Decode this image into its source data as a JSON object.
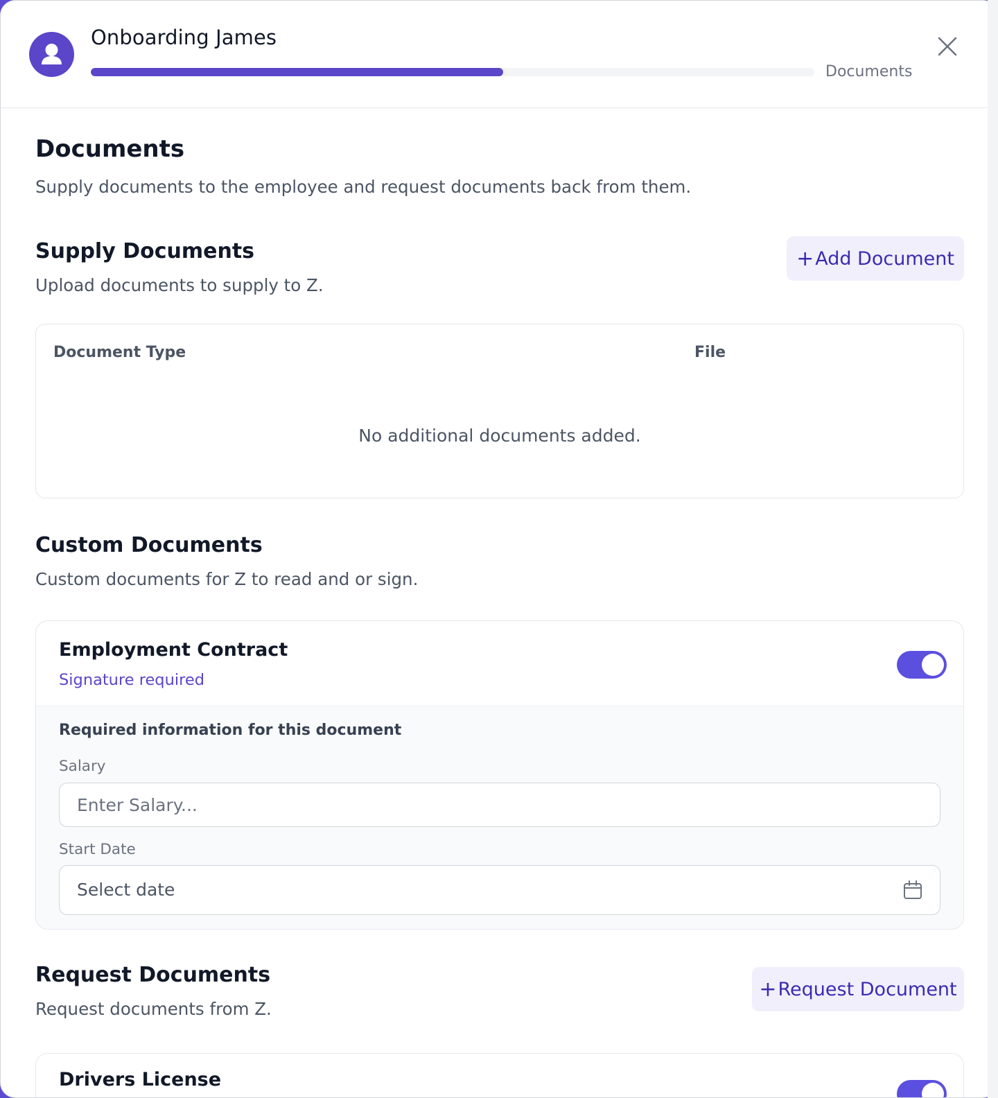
{
  "header": {
    "title": "Onboarding James",
    "progress_percent": 57,
    "step_label": "Documents",
    "avatar_icon": "user-icon",
    "close_icon": "close-icon"
  },
  "intro": {
    "title": "Documents",
    "description": "Supply documents to the employee and request documents back from them."
  },
  "supply": {
    "title": "Supply Documents",
    "description": "Upload documents to supply to Z.",
    "add_button": "Add Document",
    "columns": [
      "Document Type",
      "File"
    ],
    "empty_message": "No additional documents added."
  },
  "custom": {
    "title": "Custom Documents",
    "description": "Custom documents for Z to read and or sign.",
    "card": {
      "title": "Employment Contract",
      "subtitle": "Signature required",
      "enabled": true,
      "fields_title": "Required information for this document",
      "salary_label": "Salary",
      "salary_placeholder": "Enter Salary...",
      "start_date_label": "Start Date",
      "start_date_placeholder": "Select date"
    }
  },
  "request": {
    "title": "Request Documents",
    "description": "Request documents from Z.",
    "request_button": "Request Document",
    "card": {
      "title": "Drivers License",
      "enabled": true
    }
  },
  "colors": {
    "accent": "#5b45c9",
    "toggle": "#5b4fe0",
    "button_bg": "#f1effc",
    "button_text": "#3b2bb0"
  }
}
